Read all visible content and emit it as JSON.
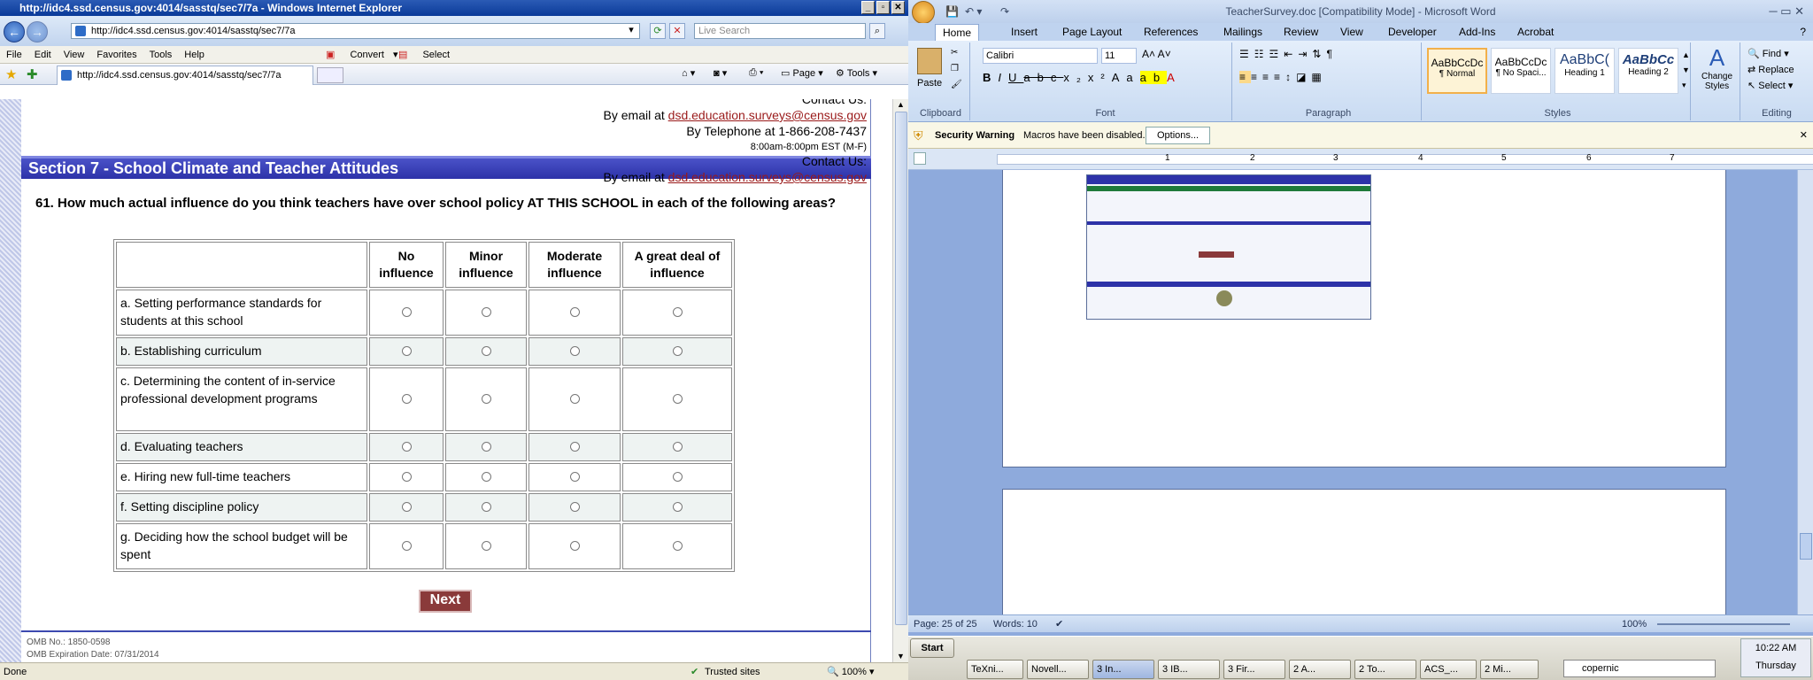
{
  "ie": {
    "title": "http://idc4.ssd.census.gov:4014/sasstq/sec7/7a - Windows Internet Explorer",
    "address": "http://idc4.ssd.census.gov:4014/sasstq/sec7/7a",
    "search_placeholder": "Live Search",
    "menu": [
      "File",
      "Edit",
      "View",
      "Favorites",
      "Tools",
      "Help"
    ],
    "convert_label": "Convert",
    "select_label": "Select",
    "tab_title": "http://idc4.ssd.census.gov:4014/sasstq/sec7/7a",
    "cmd": {
      "page": "Page",
      "tools": "Tools"
    },
    "status": {
      "left": "Done",
      "zone": "Trusted sites",
      "zoom": "100%"
    }
  },
  "page": {
    "contact_top": {
      "label": "Contact Us:",
      "email_prefix": "By email at ",
      "email": "dsd.education.surveys@census.gov",
      "phone": "By Telephone at 1-866-208-7437",
      "hours": "8:00am-8:00pm EST (M-F)"
    },
    "section_title": "Section 7 - School Climate and Teacher Attitudes",
    "contact_mid": {
      "label": "Contact Us:",
      "email_prefix": "By email at ",
      "email": "dsd.education.surveys@census.gov"
    },
    "question": "61. How much actual influence do you think teachers have over school policy AT THIS SCHOOL in each of the following areas?",
    "columns": [
      "No influence",
      "Minor influence",
      "Moderate influence",
      "A great deal of influence"
    ],
    "rows": [
      "a. Setting performance standards for students at this school",
      "b. Establishing curriculum",
      "c. Determining the content of in-service professional development programs",
      "d. Evaluating teachers",
      "e. Hiring new full-time teachers",
      "f. Setting discipline policy",
      "g. Deciding how the school budget will be spent"
    ],
    "next_label": "Next",
    "omb_no": "OMB No.: 1850-0598",
    "omb_exp": "OMB Expiration Date: 07/31/2014"
  },
  "word": {
    "title": "TeacherSurvey.doc [Compatibility Mode] - Microsoft Word",
    "tabs": [
      "Home",
      "Insert",
      "Page Layout",
      "References",
      "Mailings",
      "Review",
      "View",
      "Developer",
      "Add-Ins",
      "Acrobat"
    ],
    "paste_label": "Paste",
    "font_name": "Calibri",
    "font_size": "11",
    "groups": {
      "clipboard": "Clipboard",
      "font": "Font",
      "paragraph": "Paragraph",
      "styles": "Styles",
      "editing": "Editing"
    },
    "styles": [
      {
        "preview": "AaBbCcDc",
        "name": "¶ Normal"
      },
      {
        "preview": "AaBbCcDc",
        "name": "¶ No Spaci..."
      },
      {
        "preview": "AaBbC(",
        "name": "Heading 1"
      },
      {
        "preview": "AaBbCc",
        "name": "Heading 2"
      }
    ],
    "change_styles": "Change Styles",
    "editing": {
      "find": "Find",
      "replace": "Replace",
      "select": "Select"
    },
    "security_warning": "Security Warning",
    "macros_msg": "Macros have been disabled.",
    "options_label": "Options...",
    "ruler_nums": [
      "1",
      "2",
      "3",
      "4",
      "5",
      "6",
      "7"
    ],
    "status": {
      "page": "Page: 25 of 25",
      "words": "Words: 10",
      "zoom": "100%"
    }
  },
  "taskbar": {
    "start": "Start",
    "items": [
      "TeXni...",
      "Novell...",
      "3 In...",
      "3 IB...",
      "3 Fir...",
      "2 A...",
      "2 To...",
      "ACS_...",
      "2 Mi..."
    ],
    "search_text": "copernic",
    "time": "10:22 AM",
    "day": "Thursday"
  },
  "colors": {
    "section_bar": "#2d32a8",
    "link": "#9a1a1a",
    "next_button": "#8a3a3a",
    "word_bg": "#8eaadc"
  }
}
